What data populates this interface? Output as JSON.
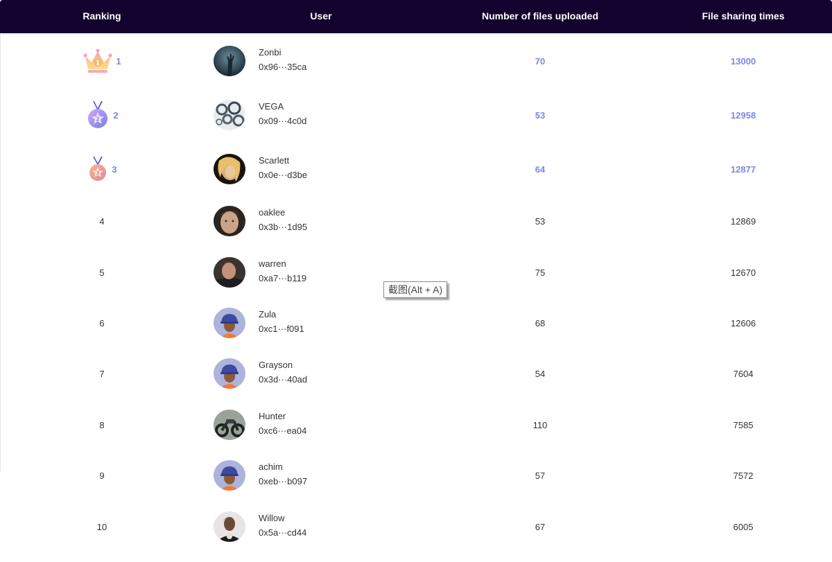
{
  "table": {
    "headers": {
      "ranking": "Ranking",
      "user": "User",
      "files": "Number of files uploaded",
      "sharing": "File sharing times"
    },
    "rows": [
      {
        "rank": "1",
        "name": "Zonbi",
        "address": "0x96···35ca",
        "files": "70",
        "sharing": "13000",
        "badge": "crown-icon",
        "avatar": "zombie-hand-photo"
      },
      {
        "rank": "2",
        "name": "VEGA",
        "address": "0x09···4c0d",
        "files": "53",
        "sharing": "12958",
        "badge": "silver-medal-icon",
        "avatar": "gears-photo"
      },
      {
        "rank": "3",
        "name": "Scarlett",
        "address": "0x0e···d3be",
        "files": "64",
        "sharing": "12877",
        "badge": "bronze-medal-icon",
        "avatar": "portrait-photo"
      },
      {
        "rank": "4",
        "name": "oaklee",
        "address": "0x3b···1d95",
        "files": "53",
        "sharing": "12869",
        "avatar": "portrait-photo"
      },
      {
        "rank": "5",
        "name": "warren",
        "address": "0xa7···b119",
        "files": "75",
        "sharing": "12670",
        "avatar": "portrait-photo"
      },
      {
        "rank": "6",
        "name": "Zula",
        "address": "0xc1···f091",
        "files": "68",
        "sharing": "12606",
        "avatar": "default-helmet-avatar"
      },
      {
        "rank": "7",
        "name": "Grayson",
        "address": "0x3d···40ad",
        "files": "54",
        "sharing": "7604",
        "avatar": "default-helmet-avatar"
      },
      {
        "rank": "8",
        "name": "Hunter",
        "address": "0xc6···ea04",
        "files": "110",
        "sharing": "7585",
        "avatar": "motorcycle-photo"
      },
      {
        "rank": "9",
        "name": "achim",
        "address": "0xeb···b097",
        "files": "57",
        "sharing": "7572",
        "avatar": "default-helmet-avatar"
      },
      {
        "rank": "10",
        "name": "Willow",
        "address": "0x5a···cd44",
        "files": "67",
        "sharing": "6005",
        "avatar": "portrait-photo"
      }
    ]
  },
  "tooltip": {
    "label": "截图(Alt + A)"
  },
  "colors": {
    "header_bg": "#13012e",
    "header_text": "#ffffff",
    "top_rank_accent": "#7b86e8",
    "body_text": "#333333"
  }
}
